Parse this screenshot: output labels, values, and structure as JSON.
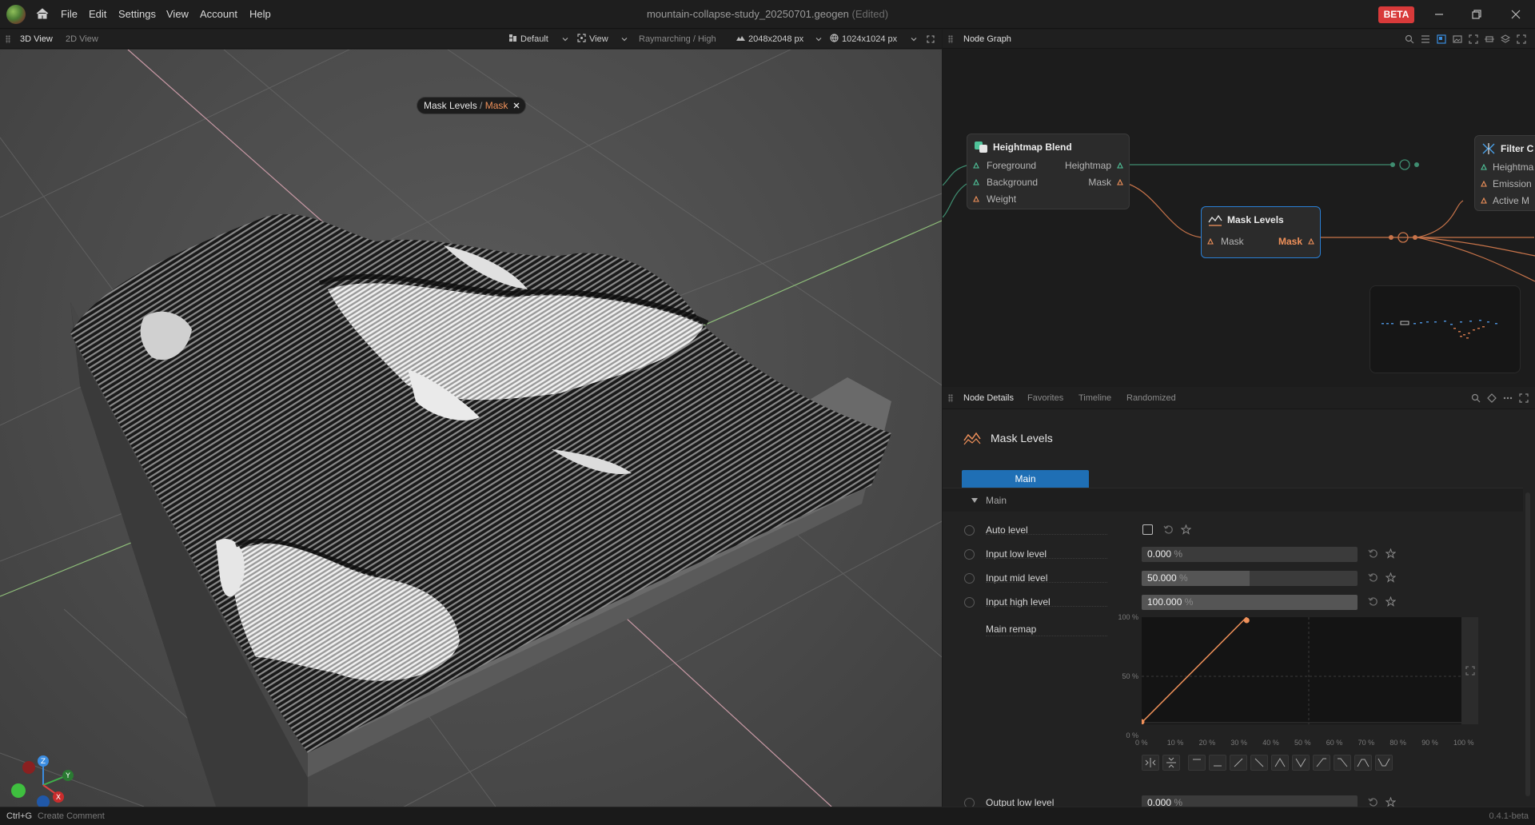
{
  "app": {
    "menu": [
      "File",
      "Edit",
      "Settings",
      "View",
      "Account",
      "Help"
    ],
    "document_title": "mountain-collapse-study_20250701.geogen",
    "edited_suffix": "(Edited)",
    "beta_badge": "BETA"
  },
  "view_panel": {
    "tabs": [
      "3D View",
      "2D View"
    ],
    "active_tab": "3D View",
    "toolbar": {
      "preset": "Default",
      "view_menu": "View",
      "render_mode": "Raymarching / High",
      "terrain_resolution": "2048x2048 px",
      "texture_resolution": "1024x1024 px"
    },
    "breadcrumb": {
      "node": "Mask Levels",
      "separator": "/",
      "output": "Mask"
    },
    "gizmo_axes": [
      "Z",
      "Y",
      "X"
    ]
  },
  "node_graph": {
    "title": "Node Graph",
    "nodes": {
      "heightmap_blend": {
        "title": "Heightmap Blend",
        "inputs": [
          "Foreground",
          "Background",
          "Weight"
        ],
        "outputs": [
          "Heightmap",
          "Mask"
        ]
      },
      "mask_levels": {
        "title": "Mask Levels",
        "inputs": [
          "Mask"
        ],
        "outputs": [
          "Mask"
        ]
      },
      "filter": {
        "title": "Filter C",
        "inputs": [
          "Heightma",
          "Emission",
          "Active M"
        ]
      }
    }
  },
  "node_details": {
    "tabs": [
      "Node Details",
      "Favorites",
      "Timeline",
      "Randomized"
    ],
    "active_tab": "Node Details",
    "node_title": "Mask Levels",
    "section_tab": "Main",
    "group_label": "Main",
    "auto_level": {
      "label": "Auto level",
      "checked": false
    },
    "params": [
      {
        "label": "Input low level",
        "value": "0.000",
        "unit": "%",
        "fraction": 0.0
      },
      {
        "label": "Input mid level",
        "value": "50.000",
        "unit": "%",
        "fraction": 0.5
      },
      {
        "label": "Input high level",
        "value": "100.000",
        "unit": "%",
        "fraction": 1.0
      }
    ],
    "remap": {
      "label": "Main remap",
      "y_ticks": [
        "100 %",
        "50 %",
        "0 %"
      ],
      "x_ticks": [
        "0 %",
        "10 %",
        "20 %",
        "30 %",
        "40 %",
        "50 %",
        "60 %",
        "70 %",
        "80 %",
        "90 %",
        "100 %"
      ],
      "curve_points": [
        [
          0,
          0
        ],
        [
          33,
          100
        ]
      ],
      "curve_color": "#f0915a"
    },
    "output_low": {
      "label": "Output low level",
      "value": "0.000",
      "unit": "%",
      "fraction": 0.0
    }
  },
  "status_bar": {
    "shortcut": "Ctrl+G",
    "hint": "Create Comment",
    "version": "0.4.1-beta"
  },
  "colors": {
    "accent_blue": "#1f6fb5",
    "mask_orange": "#f0915a",
    "heightmap_green": "#4fc49a",
    "beta_red": "#d83a3a"
  }
}
